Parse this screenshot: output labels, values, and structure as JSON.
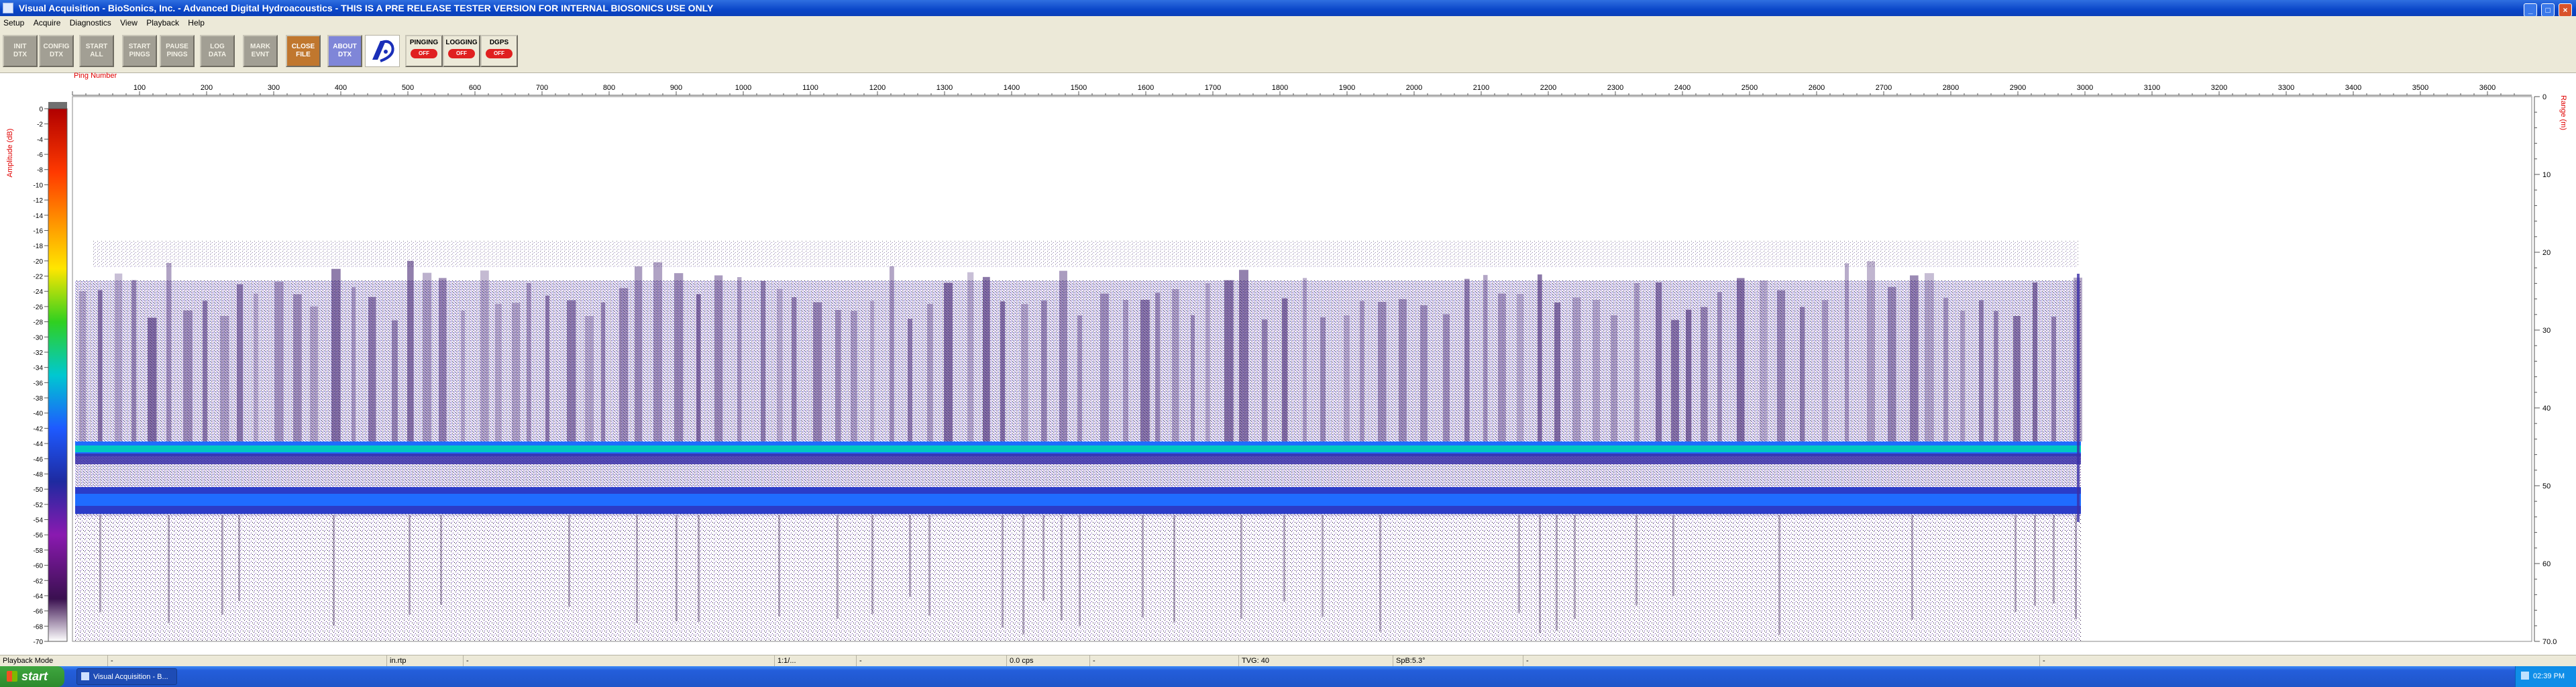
{
  "window": {
    "title": "Visual Acquisition  -  BioSonics, Inc.   -   Advanced Digital Hydroacoustics   -   THIS IS A PRE RELEASE TESTER VERSION FOR INTERNAL BIOSONICS USE ONLY",
    "minimize": "_",
    "maximize": "□",
    "close": "×"
  },
  "menu": [
    "Setup",
    "Acquire",
    "Diagnostics",
    "View",
    "Playback",
    "Help"
  ],
  "toolbar": {
    "buttons": [
      "INIT\nDTX",
      "CONFIG\nDTX",
      "START\nALL",
      "START\nPINGS",
      "PAUSE\nPINGS",
      "LOG\nDATA",
      "MARK\nEVNT",
      "CLOSE\nFILE",
      "ABOUT\nDTX"
    ],
    "indicators": [
      {
        "label": "PINGING",
        "state": "OFF"
      },
      {
        "label": "LOGGING",
        "state": "OFF"
      },
      {
        "label": "DGPS",
        "state": "OFF"
      }
    ]
  },
  "echogram": {
    "ping_axis_label": "Ping Number",
    "ping_ticks": [
      "100",
      "200",
      "300",
      "400",
      "500",
      "600",
      "700",
      "800",
      "900",
      "1000",
      "1100",
      "1200",
      "1300",
      "1400",
      "1500",
      "1600",
      "1700",
      "1800",
      "1900",
      "2000",
      "2100",
      "2200",
      "2300",
      "2400",
      "2500",
      "2600",
      "2700",
      "2800",
      "2900",
      "3000",
      "3100",
      "3200",
      "3300",
      "3400",
      "3500",
      "3600"
    ],
    "amplitude_label": "Amplitude (dB)",
    "amplitude_ticks": [
      "0",
      "-2",
      "-4",
      "-6",
      "-8",
      "-10",
      "-12",
      "-14",
      "-16",
      "-18",
      "-20",
      "-22",
      "-24",
      "-26",
      "-28",
      "-30",
      "-32",
      "-34",
      "-36",
      "-38",
      "-40",
      "-42",
      "-44",
      "-46",
      "-48",
      "-50",
      "-52",
      "-54",
      "-56",
      "-58",
      "-60",
      "-62",
      "-64",
      "-66",
      "-68",
      "-70"
    ],
    "range_label": "Range (m)",
    "range_ticks": [
      "0",
      "10",
      "20",
      "30",
      "40",
      "50",
      "60",
      "70.0"
    ],
    "colors": {
      "background": "#ffffff",
      "noise": "#3a1a6b",
      "bottom": "#2090ff",
      "bottom_core": "#00c8c0",
      "label_red": "#e00000"
    }
  },
  "status": [
    "Playback Mode",
    "-",
    "in.rtp",
    "-",
    "1:1/...",
    "-",
    "0.0 cps",
    "-",
    "TVG: 40",
    "SpB:5.3°",
    "-",
    "-"
  ],
  "taskbar": {
    "start": "start",
    "task": "Visual Acquisition - B...",
    "clock": "02:39 PM"
  }
}
